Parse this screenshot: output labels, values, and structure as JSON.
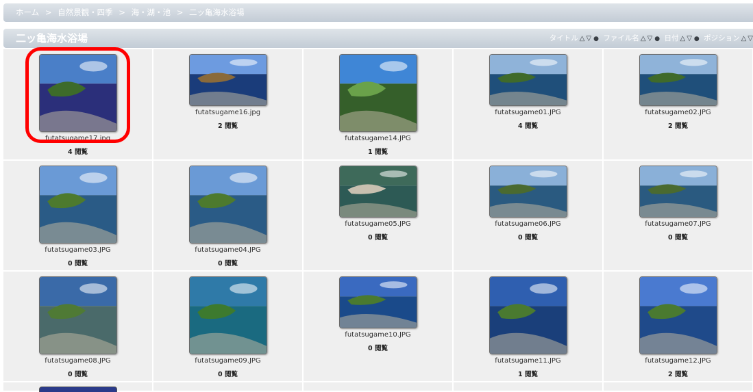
{
  "breadcrumb": {
    "items": [
      "ホーム",
      "自然景観・四季",
      "海・湖・池",
      "二ッ亀海水浴場"
    ],
    "separator": ">"
  },
  "album": {
    "title": "二ッ亀海水浴場",
    "sort_options": [
      {
        "label": "タイトル",
        "up": "△",
        "down": "▽"
      },
      {
        "label": "ファイル名",
        "up": "△",
        "down": "▽"
      },
      {
        "label": "日付",
        "up": "△",
        "down": "▽"
      },
      {
        "label": "ポジション",
        "up": "△",
        "down": "▽"
      }
    ]
  },
  "items": [
    {
      "file": "futatsugame17.jpg",
      "views": "4 閲覧",
      "orientation": "portrait"
    },
    {
      "file": "futatsugame16.jpg",
      "views": "2 閲覧",
      "orientation": "landscape"
    },
    {
      "file": "futatsugame14.JPG",
      "views": "1 閲覧",
      "orientation": "portrait"
    },
    {
      "file": "futatsugame01.JPG",
      "views": "4 閲覧",
      "orientation": "landscape"
    },
    {
      "file": "futatsugame02.JPG",
      "views": "2 閲覧",
      "orientation": "landscape"
    },
    {
      "file": "futatsugame03.JPG",
      "views": "0 閲覧",
      "orientation": "portrait"
    },
    {
      "file": "futatsugame04.JPG",
      "views": "0 閲覧",
      "orientation": "portrait"
    },
    {
      "file": "futatsugame05.JPG",
      "views": "0 閲覧",
      "orientation": "landscape"
    },
    {
      "file": "futatsugame06.JPG",
      "views": "0 閲覧",
      "orientation": "landscape"
    },
    {
      "file": "futatsugame07.JPG",
      "views": "0 閲覧",
      "orientation": "landscape"
    },
    {
      "file": "futatsugame08.JPG",
      "views": "0 閲覧",
      "orientation": "portrait"
    },
    {
      "file": "futatsugame09.JPG",
      "views": "0 閲覧",
      "orientation": "portrait"
    },
    {
      "file": "futatsugame10.JPG",
      "views": "0 閲覧",
      "orientation": "landscape"
    },
    {
      "file": "futatsugame11.JPG",
      "views": "1 閲覧",
      "orientation": "portrait"
    },
    {
      "file": "futatsugame12.JPG",
      "views": "2 閲覧",
      "orientation": "portrait"
    }
  ],
  "colors": {
    "header_gradient_top": "#dfe4e9",
    "header_gradient_bottom": "#c3ccd6",
    "cell_background": "#efefef",
    "highlight": "#ff0000"
  }
}
